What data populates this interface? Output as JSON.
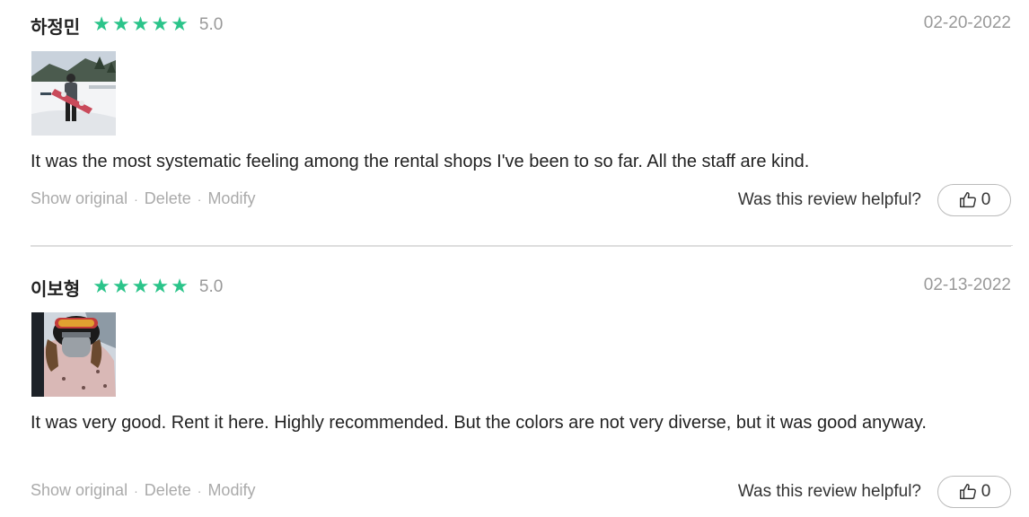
{
  "reviews": [
    {
      "reviewer_name": "하정민",
      "stars": [
        "★",
        "★",
        "★",
        "★",
        "★"
      ],
      "rating": 5.0,
      "rating_text": "5.0",
      "date": "02-20-2022",
      "photo_icon": "snowboarder-photo",
      "text": "It was the most systematic feeling among the rental shops I've been to so far. All the staff are kind.",
      "actions": {
        "show_original": "Show original",
        "delete": "Delete",
        "modify": "Modify",
        "separator": "·"
      },
      "helpful_label": "Was this review helpful?",
      "helpful_count": "0",
      "thumb_icon": "thumbs-up-icon"
    },
    {
      "reviewer_name": "이보형",
      "stars": [
        "★",
        "★",
        "★",
        "★",
        "★"
      ],
      "rating": 5.0,
      "rating_text": "5.0",
      "date": "02-13-2022",
      "photo_icon": "selfie-photo",
      "text": "It was very good. Rent it here. Highly recommended. But the colors are not very diverse, but it was good anyway.",
      "actions": {
        "show_original": "Show original",
        "delete": "Delete",
        "modify": "Modify",
        "separator": "·"
      },
      "helpful_label": "Was this review helpful?",
      "helpful_count": "0",
      "thumb_icon": "thumbs-up-icon"
    }
  ],
  "colors": {
    "star": "#2bc48a",
    "muted_text": "#999999",
    "divider": "#dddddd"
  }
}
